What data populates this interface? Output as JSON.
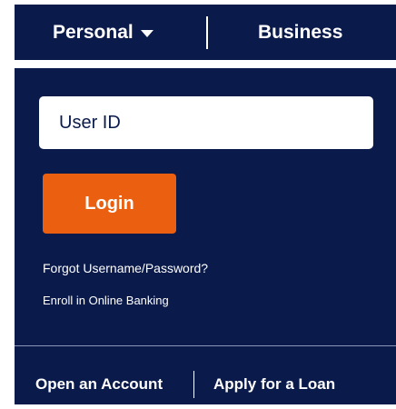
{
  "tabs": {
    "personal_label": "Personal",
    "business_label": "Business"
  },
  "login_form": {
    "userid_placeholder": "User ID",
    "login_label": "Login",
    "forgot_link": "Forgot Username/Password?",
    "enroll_link": "Enroll in Online Banking"
  },
  "footer": {
    "open_account": "Open an Account",
    "apply_loan": "Apply for a Loan"
  },
  "colors": {
    "navy": "#0a1a4a",
    "accent_orange": "#ea6010",
    "white": "#ffffff"
  },
  "icons": {
    "personal_dropdown": "caret-down-icon"
  }
}
